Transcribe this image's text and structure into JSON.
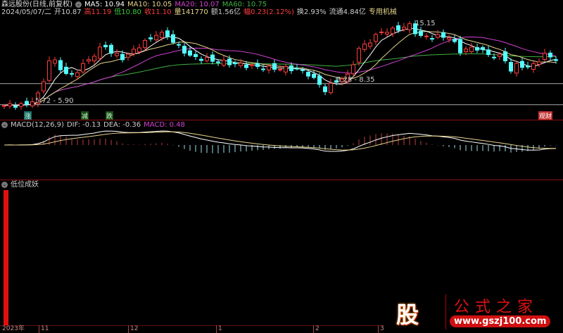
{
  "header": {
    "stock_name": "森远股份(日线,前复权)",
    "ma5": "MA5: 10.94",
    "ma10": "MA10: 10.05",
    "ma20": "MA20: 10.07",
    "ma60": "MA60: 10.75",
    "date": "2024/05/07/二",
    "open": "开10.87",
    "high": "高11.19",
    "low": "低10.80",
    "close": "收11.10",
    "volume": "量141770",
    "amount": "额1.56亿",
    "change": "幅0.23(2.12%)",
    "turnover": "换2.93%",
    "float_cap": "流通4.84亿",
    "sector": "专用机械"
  },
  "annotations": {
    "high_label": "15.15",
    "range1": "8.28 - 8.35",
    "range2": "5.72 - 5.90",
    "mark1": "涨",
    "mark2": "减",
    "mark3": "跌",
    "mark4": "观财"
  },
  "macd_panel": {
    "title": "MACD(12,26,9)",
    "dif": "DIF: -0.13",
    "dea": "DEA: -0.36",
    "macd": "MACD: 0.48"
  },
  "indicator_panel": {
    "title": "低位成妖"
  },
  "time_axis": [
    "2023年",
    "11",
    "12",
    "1",
    "2",
    "3"
  ],
  "logo": {
    "char": "股",
    "text": "公式之家",
    "url": "www.gszj100.com"
  },
  "colors": {
    "up": "#ff3c3c",
    "down": "#54ffff",
    "ma5": "#ffffff",
    "ma10": "#e6d38a",
    "ma20": "#d040d0",
    "ma60": "#40b040"
  },
  "chart_data": {
    "type": "candlestick",
    "candle_count": 99,
    "close_keyframes": [
      [
        0,
        5.8
      ],
      [
        2,
        5.85
      ],
      [
        4,
        5.9
      ],
      [
        6,
        7.0
      ],
      [
        7,
        8.6
      ],
      [
        8,
        11.0
      ],
      [
        9,
        10.76
      ],
      [
        11,
        9.4
      ],
      [
        12,
        9.24
      ],
      [
        13,
        9.8
      ],
      [
        15,
        11.0
      ],
      [
        17,
        12.2
      ],
      [
        18,
        12.6
      ],
      [
        19,
        11.8
      ],
      [
        21,
        11.24
      ],
      [
        22,
        11.56
      ],
      [
        24,
        12.6
      ],
      [
        26,
        13.4
      ],
      [
        27,
        13.95
      ],
      [
        29,
        13.8
      ],
      [
        30,
        13.0
      ],
      [
        32,
        12.0
      ],
      [
        33,
        11.4
      ],
      [
        37,
        10.9
      ],
      [
        42,
        10.44
      ],
      [
        47,
        10.04
      ],
      [
        52,
        9.96
      ],
      [
        54,
        9.4
      ],
      [
        56,
        8.2
      ],
      [
        57,
        7.56
      ],
      [
        59,
        8.6
      ],
      [
        61,
        9.16
      ],
      [
        63,
        12.2
      ],
      [
        65,
        13.15
      ],
      [
        67,
        14.2
      ],
      [
        69,
        14.35
      ],
      [
        72,
        14.9
      ],
      [
        73,
        14.2
      ],
      [
        74,
        13.63
      ],
      [
        76,
        13.63
      ],
      [
        79,
        13.63
      ],
      [
        80,
        12.83
      ],
      [
        81,
        12.0
      ],
      [
        82,
        12.2
      ],
      [
        84,
        12.35
      ],
      [
        85,
        12.0
      ],
      [
        86,
        11.56
      ],
      [
        88,
        11.4
      ],
      [
        89,
        11.0
      ],
      [
        90,
        9.8
      ],
      [
        91,
        10.36
      ],
      [
        92,
        10.36
      ],
      [
        93,
        10.12
      ],
      [
        94,
        10.44
      ],
      [
        96,
        11.56
      ],
      [
        98,
        11.1
      ]
    ],
    "ylim": [
      5.5,
      16.0
    ],
    "reference_levels": [
      8.3,
      5.9
    ],
    "indicator_bar_value": 1
  }
}
